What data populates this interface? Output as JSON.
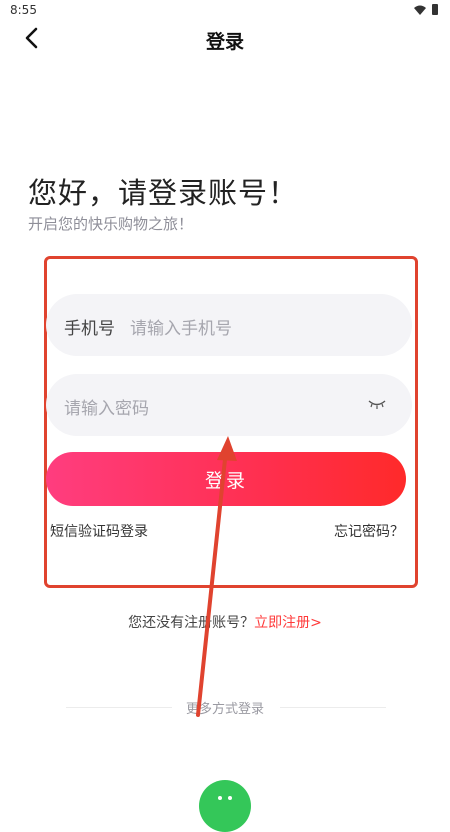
{
  "status_bar": {
    "time": "8:55"
  },
  "nav": {
    "title": "登录"
  },
  "hero": {
    "greeting": "您好，请登录账号！",
    "subtitle": "开启您的快乐购物之旅！"
  },
  "form": {
    "phone_label": "手机号",
    "phone_placeholder": "请输入手机号",
    "password_placeholder": "请输入密码",
    "login_button": "登录",
    "sms_login": "短信验证码登录",
    "forgot_password": "忘记密码？"
  },
  "register": {
    "prompt": "您还没有注册账号？",
    "link": "立即注册>"
  },
  "more_login": {
    "label": "更多方式登录",
    "icons": [
      "wechat-icon"
    ]
  },
  "colors": {
    "accent": "#ff2f4f",
    "annotation": "#e0432f",
    "wechat": "#34c759"
  }
}
